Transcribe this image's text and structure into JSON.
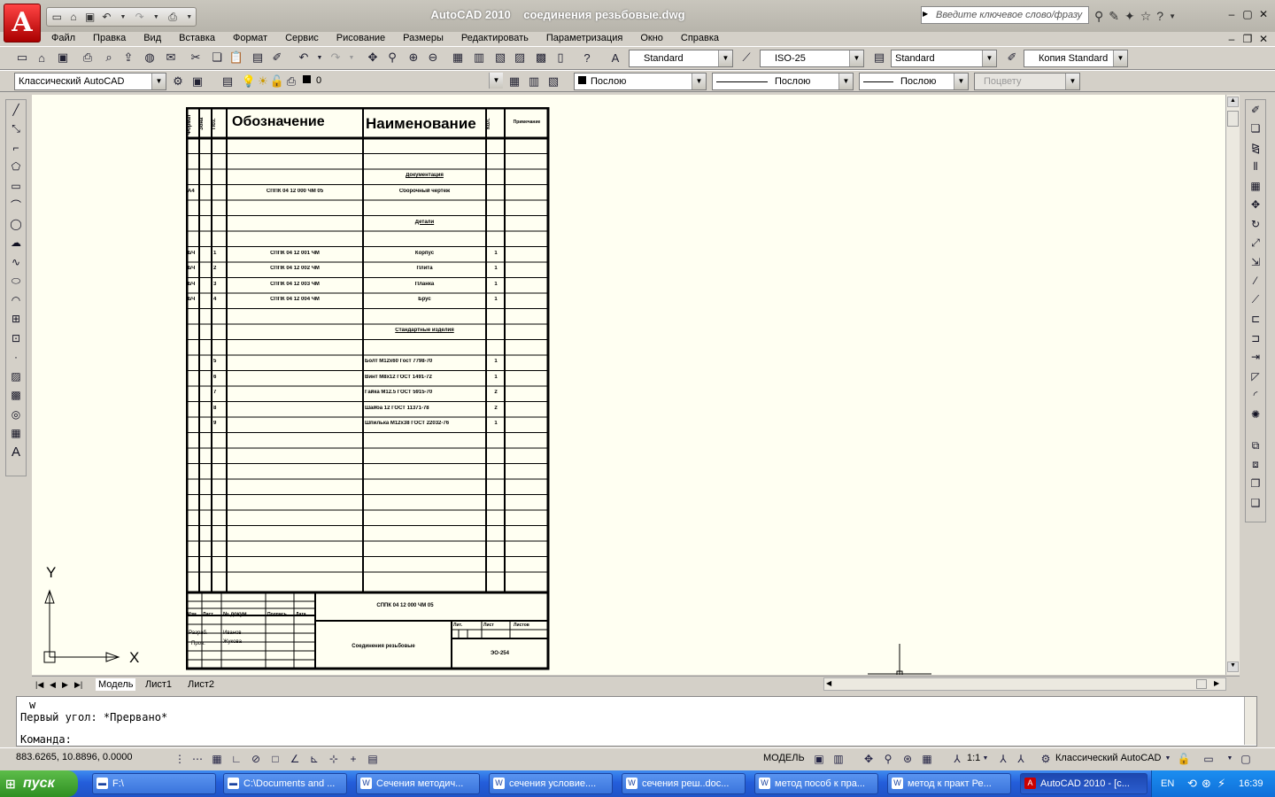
{
  "app": {
    "title": "AutoCAD 2010",
    "file": "соединения резьбовые.dwg",
    "logo": "A",
    "search_placeholder": "Введите ключевое слово/фразу"
  },
  "menu": [
    "Файл",
    "Правка",
    "Вид",
    "Вставка",
    "Формат",
    "Сервис",
    "Рисование",
    "Размеры",
    "Редактировать",
    "Параметризация",
    "Окно",
    "Справка"
  ],
  "toolbar1": {
    "text_style": "Standard",
    "dim_style": "ISO-25",
    "table_style": "Standard",
    "multileader_style": "Копия Standard"
  },
  "toolbar2": {
    "workspace": "Классический AutoCAD",
    "layer": "0",
    "color": "Послою",
    "linetype": "Послою",
    "lineweight": "Послою",
    "plotstyle": "Поцвету"
  },
  "ucs": {
    "x": "X",
    "y": "Y"
  },
  "tabs": [
    "Модель",
    "Лист1",
    "Лист2"
  ],
  "command": {
    "line1": "w",
    "line2": "Первый угол: *Прервано*",
    "prompt": "Команда:"
  },
  "status": {
    "coords": "883.6265, 10.8896, 0.0000",
    "model": "МОДЕЛЬ",
    "scale": "1:1",
    "workspace": "Классический AutoCAD"
  },
  "taskbar": {
    "start": "пуск",
    "items": [
      "F:\\",
      "C:\\Documents and ...",
      "Сечения методич...",
      "сечения условие....",
      "сечения реш..doc...",
      "метод пособ к пра...",
      "метод  к практ Ре...",
      "AutoCAD 2010 - [с..."
    ],
    "lang": "EN",
    "time": "16:39"
  },
  "spec": {
    "header": {
      "format": "Формат",
      "zone": "Зона",
      "pos": "Поз.",
      "designation": "Обозначение",
      "name": "Наименование",
      "qty": "Кол.",
      "note": "Примечание"
    },
    "rows": [
      {
        "name": "Документация"
      },
      {
        "format": "А4",
        "designation": "СППК 04 12 000 ЧМ 05",
        "name": "Сборочный чертеж"
      },
      {
        "name": "Детали"
      },
      {
        "format": "БЧ",
        "pos": "1",
        "designation": "СППК 04 12 001 ЧМ",
        "name": "Корпус",
        "qty": "1"
      },
      {
        "format": "БЧ",
        "pos": "2",
        "designation": "СППК 04 12 002 ЧМ",
        "name": "Плита",
        "qty": "1"
      },
      {
        "format": "БЧ",
        "pos": "3",
        "designation": "СППК 04 12 003 ЧМ",
        "name": "Планка",
        "qty": "1"
      },
      {
        "format": "БЧ",
        "pos": "4",
        "designation": "СППК 04 12 004 ЧМ",
        "name": "Брус",
        "qty": "1"
      },
      {
        "name": "Стандартные изделия"
      },
      {
        "pos": "5",
        "name": "Болт М12х60 Гост 7798-70",
        "qty": "1"
      },
      {
        "pos": "6",
        "name": "Винт М8х12 ГОСТ 1491-72",
        "qty": "1"
      },
      {
        "pos": "7",
        "name": "Гайка М12.5 ГОСТ 5915-70",
        "qty": "2"
      },
      {
        "pos": "8",
        "name": "Шайба 12 ГОСТ 11371-78",
        "qty": "2"
      },
      {
        "pos": "9",
        "name": "Шпилька М12х38 ГОСТ 22032-76",
        "qty": "1"
      }
    ],
    "stamp": {
      "doc": "СППК 04 12 000 ЧМ 05",
      "title": "Соединения резьбовые",
      "group": "ЭО-254",
      "izm": "Изм.",
      "list": "Лист",
      "ndoc": "№ докум.",
      "sign": "Подпись",
      "date": "Дата",
      "razrab": "Разраб.",
      "prov": "Пров.",
      "author": "Иванов",
      "checker": "Жукова",
      "lit": "Лит.",
      "sheet": "Лист",
      "sheets": "Листов"
    }
  }
}
